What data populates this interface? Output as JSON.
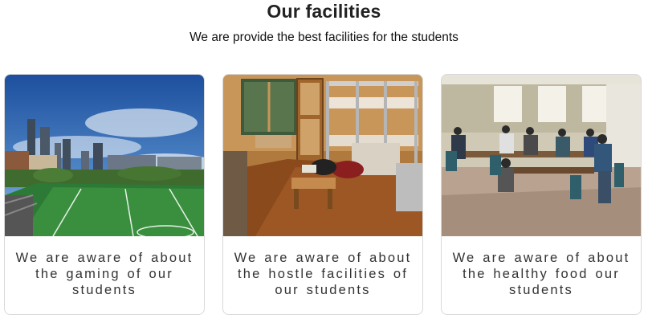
{
  "header": {
    "title": "Our facilities",
    "subtitle": "We are provide the best facilities for the students"
  },
  "cards": [
    {
      "image_alt": "campus-sports-field",
      "text": "We are aware of about the gaming of our students"
    },
    {
      "image_alt": "hostel-room-bunk-beds",
      "text": "We are aware of about the hostle facilities of our students"
    },
    {
      "image_alt": "dining-hall",
      "text": "We are aware of about the healthy food our students"
    }
  ]
}
